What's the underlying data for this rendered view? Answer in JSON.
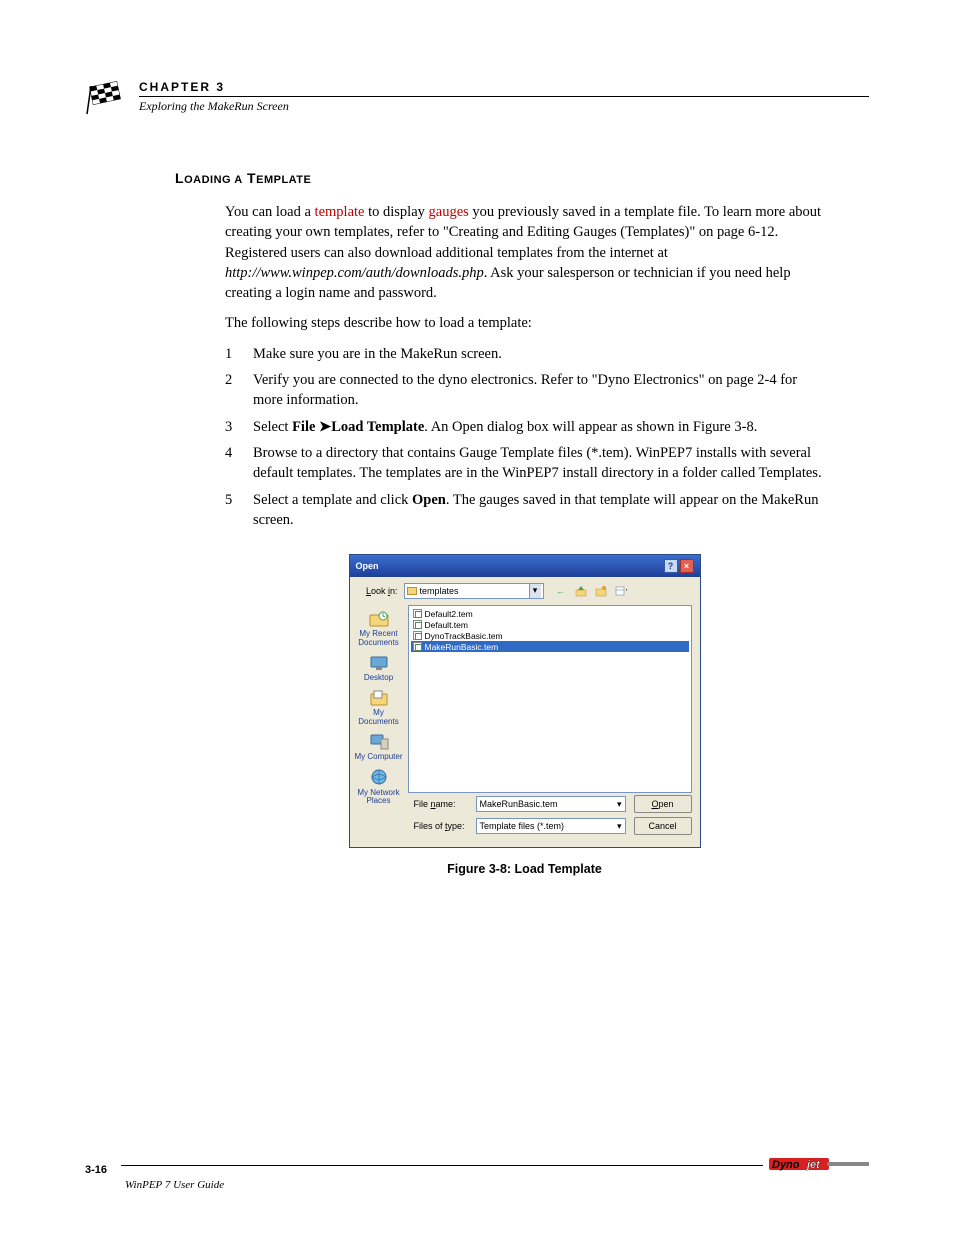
{
  "header": {
    "chapter": "CHAPTER 3",
    "subtitle": "Exploring the MakeRun Screen"
  },
  "section_title": "Loading a Template",
  "intro": {
    "p1_pre": "You can load a ",
    "p1_link1": "template",
    "p1_mid": " to display ",
    "p1_link2": "gauges",
    "p1_post": " you previously saved in a template file. To learn more about creating your own templates, refer to \"Creating and Editing Gauges (Templates)\" on page 6-12. Registered users can also download additional templates from the internet at ",
    "p1_url": "http://www.winpep.com/auth/downloads.php",
    "p1_tail": ". Ask your salesperson or technician if you need help creating a login name and password.",
    "p2": "The following steps describe how to load a template:"
  },
  "steps": [
    {
      "text": "Make sure you are in the MakeRun screen."
    },
    {
      "text": "Verify you are connected to the dyno electronics. Refer to \"Dyno Electronics\" on page 2-4 for more information."
    },
    {
      "pre": "Select ",
      "b1": "File",
      "arrow": " ➤",
      "b2": "Load Template",
      "post": ". An Open dialog box will appear as shown in Figure 3-8."
    },
    {
      "text": "Browse to a directory that contains Gauge Template files (*.tem). WinPEP7 installs with several default templates. The templates are in the WinPEP7 install directory in a folder called Templates."
    },
    {
      "pre": "Select a template and click ",
      "b1": "Open",
      "post": ". The gauges saved in that template will appear on the MakeRun screen."
    }
  ],
  "dialog": {
    "title": "Open",
    "lookin_label": "Look in:",
    "lookin_value": "templates",
    "toolbar_icons": [
      "back-icon",
      "up-icon",
      "new-folder-icon",
      "views-icon"
    ],
    "places": [
      {
        "label": "My Recent Documents"
      },
      {
        "label": "Desktop"
      },
      {
        "label": "My Documents"
      },
      {
        "label": "My Computer"
      },
      {
        "label": "My Network Places"
      }
    ],
    "files": [
      {
        "name": "Default2.tem",
        "sel": false
      },
      {
        "name": "Default.tem",
        "sel": false
      },
      {
        "name": "DynoTrackBasic.tem",
        "sel": false
      },
      {
        "name": "MakeRunBasic.tem",
        "sel": true
      }
    ],
    "filename_label": "File name:",
    "filename_value": "MakeRunBasic.tem",
    "filetype_label": "Files of type:",
    "filetype_value": "Template files (*.tem)",
    "open_btn": "Open",
    "cancel_btn": "Cancel"
  },
  "figure_caption": "Figure 3-8: Load Template",
  "footer": {
    "page": "3-16",
    "guide": "WinPEP 7 User Guide",
    "brand": "Dynojet"
  }
}
